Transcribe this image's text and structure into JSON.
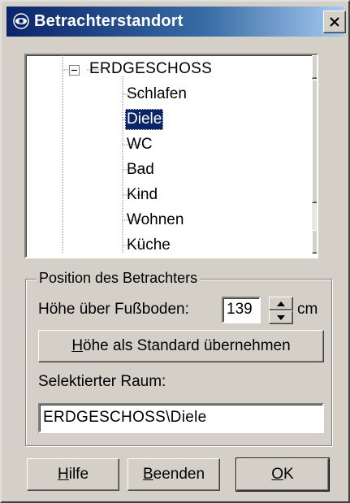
{
  "window": {
    "title": "Betrachterstandort",
    "close_label": "X"
  },
  "tree": {
    "root_label": "ERDGESCHOSS",
    "root_state": "expanded",
    "items": [
      {
        "label": "Schlafen",
        "selected": false
      },
      {
        "label": "Diele",
        "selected": true
      },
      {
        "label": "WC",
        "selected": false
      },
      {
        "label": "Bad",
        "selected": false
      },
      {
        "label": "Kind",
        "selected": false
      },
      {
        "label": "Wohnen",
        "selected": false
      },
      {
        "label": "Küche",
        "selected": false
      }
    ]
  },
  "position_group": {
    "legend": "Position des Betrachters",
    "height_label": "Höhe über Fußboden:",
    "height_value": "139",
    "height_unit": "cm",
    "set_default_button": {
      "accel": "H",
      "rest": "öhe als Standard übernehmen"
    },
    "selected_room_label": "Selektierter Raum:",
    "selected_room_value": "ERDGESCHOSS\\Diele"
  },
  "buttons": {
    "help": {
      "accel": "H",
      "rest": "ilfe"
    },
    "quit": {
      "accel": "B",
      "rest": "eenden"
    },
    "ok": {
      "accel": "O",
      "rest": "K"
    }
  },
  "colors": {
    "title_start": "#0a246a",
    "title_end": "#a6caf0",
    "selection": "#0a246a",
    "face": "#d4d0c8"
  },
  "icons": {
    "title": "eye-icon",
    "close": "close-icon",
    "scroll_up": "arrow-up-icon",
    "scroll_down": "arrow-down-icon",
    "spin_up": "arrow-up-icon",
    "spin_down": "arrow-down-icon",
    "tree_toggle": "minus-box-icon"
  }
}
